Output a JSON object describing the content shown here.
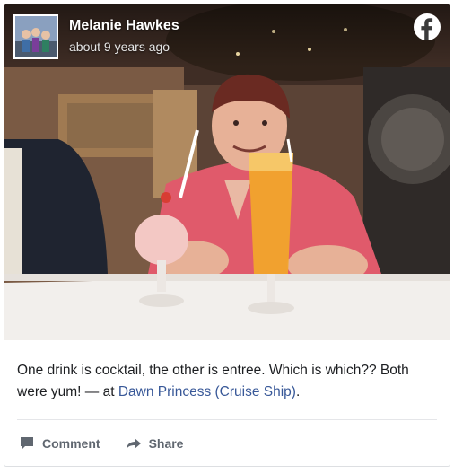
{
  "post": {
    "author": "Melanie Hawkes",
    "timestamp": "about 9 years ago",
    "caption_text": "One drink is cocktail, the other is entree. Which is which?? Both were yum! — at ",
    "place": "Dawn Princess (Cruise Ship)",
    "caption_end": ".",
    "platform_icon": "facebook-icon",
    "photo_icon": "photo-restaurant-table-with-drinks"
  },
  "actions": {
    "comment_label": "Comment",
    "comment_icon": "comment-icon",
    "share_label": "Share",
    "share_icon": "share-arrow-icon"
  },
  "colors": {
    "link": "#385898",
    "action_text": "#606770",
    "facebook_white": "#ffffff"
  }
}
